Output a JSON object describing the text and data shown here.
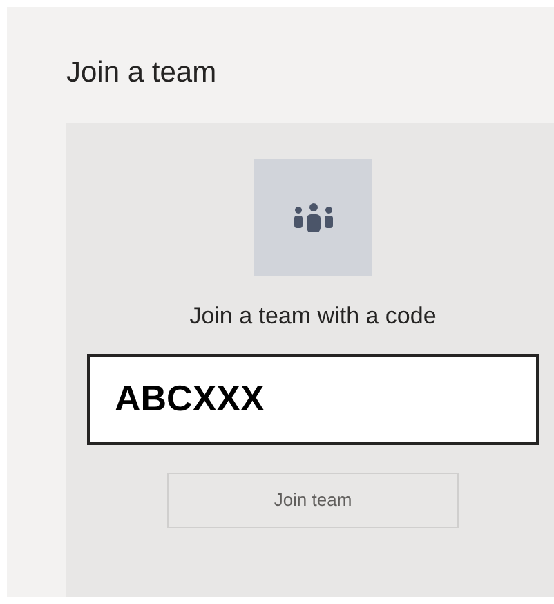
{
  "title": "Join a team",
  "card": {
    "heading": "Join a team with a code",
    "code_field": {
      "value": "ABCXXX"
    },
    "button": {
      "label": "Join team",
      "disabled": true
    }
  }
}
